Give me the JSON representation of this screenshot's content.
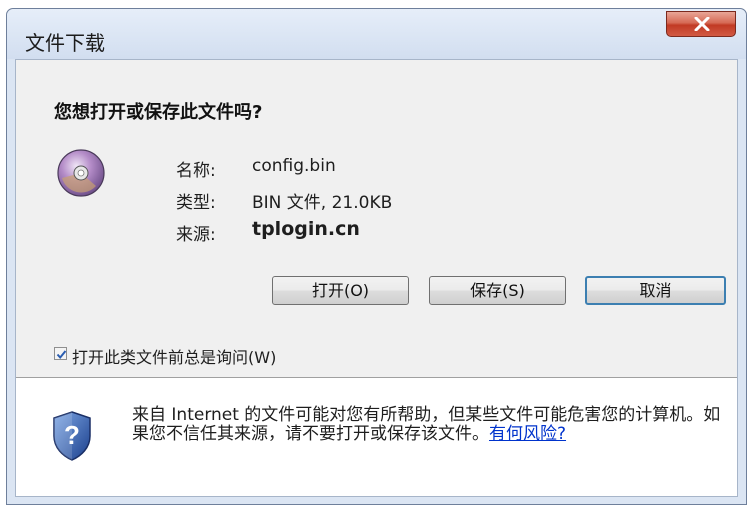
{
  "window": {
    "title": "文件下载",
    "close_icon": "close-icon"
  },
  "dialog": {
    "question": "您想打开或保存此文件吗?",
    "file_icon": "cd-disc-icon",
    "name_label": "名称:",
    "name_value": "config.bin",
    "type_label": "类型:",
    "type_value": "BIN 文件, 21.0KB",
    "source_label": "来源:",
    "source_value": "tplogin.cn"
  },
  "buttons": {
    "open": "打开(O)",
    "save": "保存(S)",
    "cancel": "取消"
  },
  "checkbox": {
    "label": "打开此类文件前总是询问(W)",
    "checked": true
  },
  "warning": {
    "icon": "shield-question-icon",
    "text": "来自 Internet 的文件可能对您有所帮助，但某些文件可能危害您的计算机。如果您不信任其来源，请不要打开或保存该文件。",
    "link": "有何风险?"
  },
  "colors": {
    "link": "#0033cc",
    "close_button": "#c13a24",
    "default_button_border": "#3c7fb1"
  }
}
